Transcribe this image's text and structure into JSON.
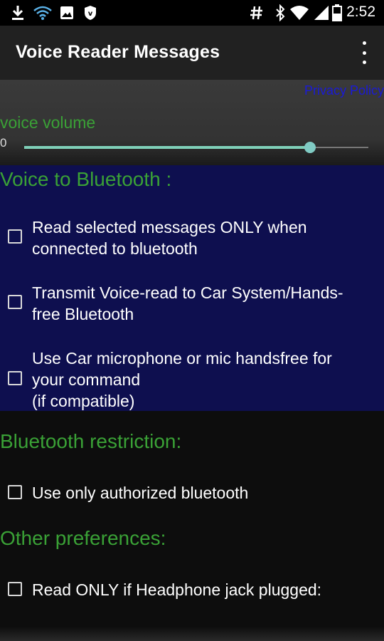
{
  "status_bar": {
    "time": "2:52",
    "left_icons": [
      "download-icon",
      "wifi-icon",
      "image-icon",
      "shield-icon"
    ],
    "right_icons": [
      "hash-icon",
      "bluetooth-icon",
      "signal-icon",
      "battery-icon"
    ]
  },
  "app_bar": {
    "title": "Voice Reader Messages",
    "menu_icon": "overflow-menu-icon"
  },
  "volume": {
    "privacy_link": "Privacy Policy",
    "label": "voice volume",
    "min_label": "0",
    "level": 0.83,
    "accent": "#80cbc4"
  },
  "bluetooth_section": {
    "heading": "Voice to Bluetooth :",
    "background": "#0e0f4f",
    "options": [
      {
        "label": "Read selected messages ONLY when\nconnected to bluetooth",
        "checked": false
      },
      {
        "label": "Transmit Voice-read to Car System/Hands-\nfree Bluetooth",
        "checked": false
      },
      {
        "label": "Use Car microphone or mic handsfree for\nyour command\n(if compatible)",
        "checked": false
      }
    ]
  },
  "restriction_section": {
    "heading": "Bluetooth restriction:",
    "options": [
      {
        "label": "Use only authorized bluetooth",
        "checked": false
      }
    ]
  },
  "other_section": {
    "heading": "Other preferences:",
    "options": [
      {
        "label": "Read ONLY if Headphone jack plugged:",
        "checked": false
      }
    ]
  },
  "colors": {
    "heading_green": "#3aa136",
    "link_blue": "#1a1ad6"
  }
}
